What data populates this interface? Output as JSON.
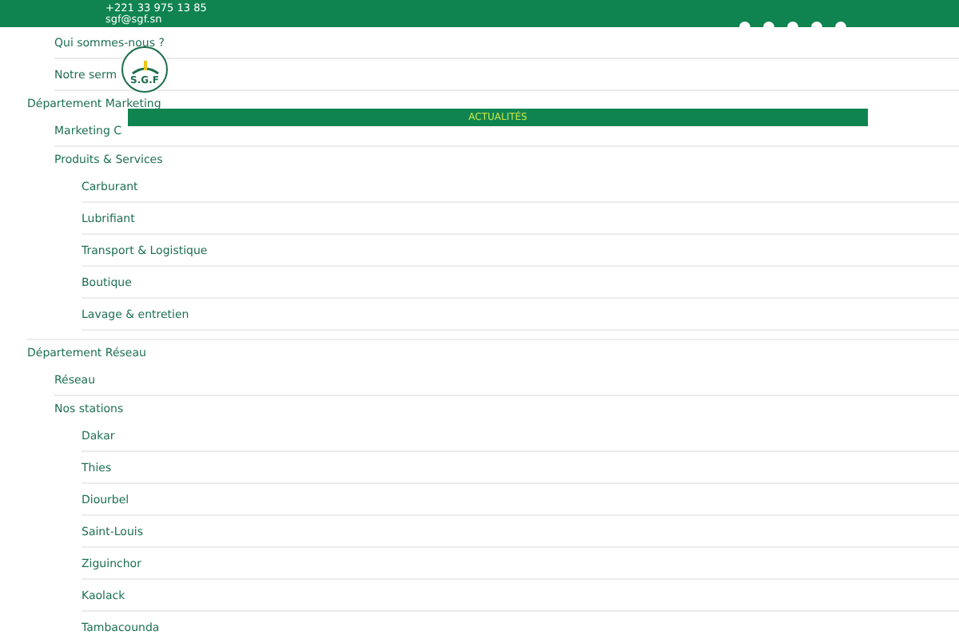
{
  "header": {
    "phone": "+221 33 975 13 85",
    "email": "sgf@sgf.sn"
  },
  "logo": {
    "text": "S.G.F"
  },
  "news_bar": {
    "label": "ACTUALITÉS"
  },
  "menu": [
    {
      "children": [
        {
          "label": "Qui sommes-nous ?"
        },
        {
          "label": "Notre serm"
        }
      ]
    },
    {
      "label": "Département Marketing",
      "children": [
        {
          "label": "Marketing C"
        },
        {
          "label": "Produits & Services",
          "children": [
            {
              "label": "Carburant"
            },
            {
              "label": "Lubrifiant"
            },
            {
              "label": "Transport & Logistique"
            },
            {
              "label": "Boutique"
            },
            {
              "label": "Lavage & entretien"
            }
          ]
        }
      ]
    },
    {
      "label": "Département Réseau",
      "children": [
        {
          "label": "Réseau"
        },
        {
          "label": "Nos stations",
          "children": [
            {
              "label": "Dakar"
            },
            {
              "label": "Thies"
            },
            {
              "label": "Diourbel"
            },
            {
              "label": "Saint-Louis"
            },
            {
              "label": "Ziguinchor"
            },
            {
              "label": "Kaolack"
            },
            {
              "label": "Tambacounda"
            }
          ]
        }
      ]
    }
  ]
}
